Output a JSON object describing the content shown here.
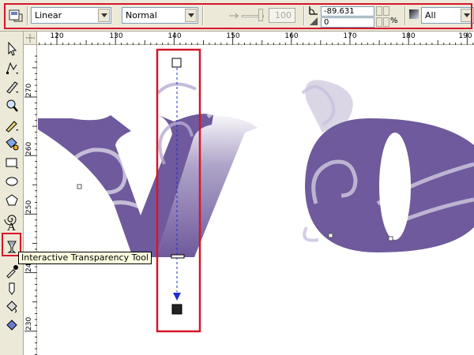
{
  "property_bar": {
    "transparency_type": "Linear",
    "merge_mode": "Normal",
    "midpoint_value": "100",
    "angle_value": "-89.631",
    "edge_pad_value": "0",
    "percent_symbol": "%",
    "apply_to": "All"
  },
  "ruler": {
    "horizontal_labels": [
      "120",
      "130",
      "140",
      "150",
      "160",
      "170",
      "180",
      "190"
    ],
    "vertical_labels": [
      "270",
      "260",
      "250",
      "240",
      "230"
    ],
    "unit_hint": "millimeters"
  },
  "toolbox": {
    "tools": [
      "pick-tool-icon",
      "shape-tool-icon",
      "knife-tool-icon",
      "zoom-tool-icon",
      "freehand-tool-icon",
      "smart-fill-tool-icon",
      "rectangle-tool-icon",
      "ellipse-tool-icon",
      "polygon-tool-icon",
      "spiral-tool-icon",
      "text-tool-icon",
      "interactive-transparency-tool-icon",
      "eyedropper-tool-icon",
      "outline-tool-icon",
      "fill-tool-icon",
      "interactive-fill-tool-icon"
    ],
    "active_tool": "interactive-transparency-tool-icon"
  },
  "tooltip": {
    "text": "Interactive Transparency Tool"
  },
  "colors": {
    "accent_red": "#d6152a",
    "artwork_purple": "#6e5a9c",
    "handle_blue": "#1f2bd6",
    "ui_background": "#ece9d8"
  }
}
